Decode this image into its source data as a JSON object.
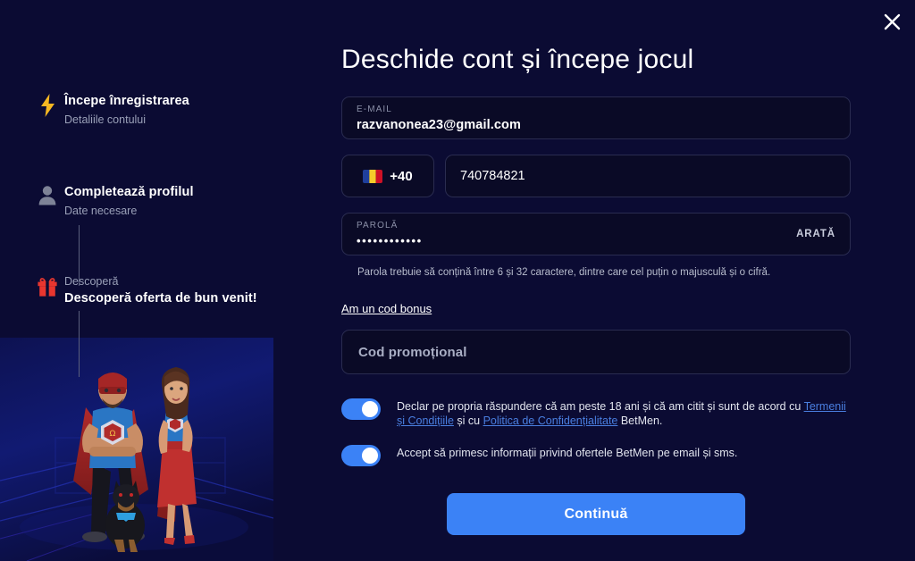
{
  "modal": {
    "title": "Deschide cont și începe jocul",
    "close_label": "×"
  },
  "stepper": {
    "steps": [
      {
        "icon": "lightning-bolt-icon",
        "title": "Începe înregistrarea",
        "subtitle": "Detaliile contului",
        "state": "active"
      },
      {
        "icon": "person-icon",
        "title": "Completează profilul",
        "subtitle": "Date necesare",
        "state": "upcoming"
      },
      {
        "icon": "gift-icon",
        "top_label": "Descoperă",
        "title": "Descoperă oferta de bun venit!",
        "state": "upcoming"
      }
    ]
  },
  "form": {
    "email": {
      "label": "E-MAIL",
      "value": "razvanonea23@gmail.com"
    },
    "phone": {
      "country_flag": "romania-flag-icon",
      "prefix": "+40",
      "value": "740784821"
    },
    "password": {
      "label": "PAROLĂ",
      "masked_value": "••••••••••••",
      "show_label": "ARATĂ",
      "hint": "Parola trebuie să conțină între 6 și 32 caractere, dintre care cel puțin o majusculă și o cifră."
    },
    "bonus": {
      "link_label": "Am un cod bonus",
      "promo_placeholder": "Cod promoțional",
      "promo_value": ""
    },
    "consents": [
      {
        "state": "on",
        "text_part_1": "Declar pe propria răspundere că am peste 18 ani și că am citit și sunt de acord cu ",
        "link_1": "Termenii și Condițiile",
        "text_part_2": " și cu ",
        "link_2": "Politica de Confidențialitate",
        "text_part_3": " BetMen."
      },
      {
        "state": "on",
        "text_part_1": "Accept să primesc informații privind ofertele BetMen pe email și sms.",
        "link_1": "",
        "text_part_2": "",
        "link_2": "",
        "text_part_3": ""
      }
    ],
    "submit_label": "Continuă"
  },
  "colors": {
    "background": "#0b0b33",
    "field_background": "#0a0a26",
    "accent_blue": "#3b82f6",
    "link_blue": "#4a7fe0",
    "bolt_gold": "#f5b722",
    "gift_red": "#e8362f",
    "step_muted": "#9aa0b8"
  }
}
